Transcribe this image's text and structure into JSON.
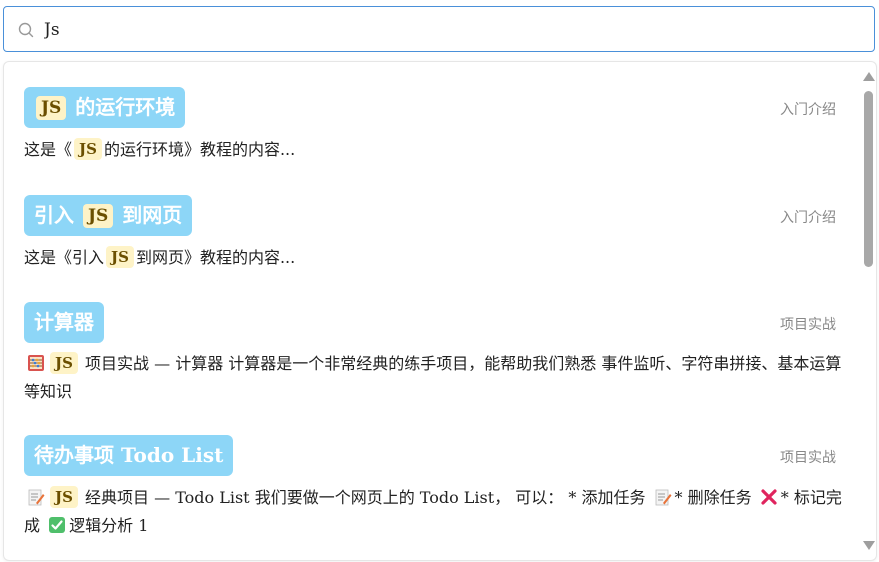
{
  "search": {
    "value": "Js",
    "placeholder": ""
  },
  "results": [
    {
      "title_pre": "",
      "title_hl": "JS",
      "title_post": "的运行环境",
      "category": "入门介绍",
      "desc_pre": "这是《",
      "desc_hl": "JS",
      "desc_post": "的运行环境》教程的内容..."
    },
    {
      "title_pre": "引入",
      "title_hl": "JS",
      "title_post": "到网页",
      "category": "入门介绍",
      "desc_pre": "这是《引入",
      "desc_hl": "JS",
      "desc_post": "到网页》教程的内容..."
    },
    {
      "title": "计算器",
      "category": "项目实战",
      "desc_hl": "JS",
      "desc_post": "项目实战 — 计算器 计算器是一个非常经典的练手项目，能帮助我们熟悉 事件监听、字符串拼接、基本运算 等知识",
      "icons": [
        "abacus-icon"
      ]
    },
    {
      "title": "待办事项 Todo List",
      "category": "项目实战",
      "desc_hl": "JS",
      "desc_part1": "经典项目 — Todo List 我们要做一个网页上的 Todo List， 可以： * 添加任务",
      "desc_part2": "* 删除任务",
      "desc_part3": "* 标记完成",
      "desc_part4": "逻辑分析 1",
      "icons": [
        "memo-icon",
        "memo-icon",
        "cross-mark-icon",
        "check-mark-icon"
      ]
    }
  ],
  "colors": {
    "title_pill_bg": "#8dd6f7",
    "highlight_bg": "#fef3c7",
    "search_border": "#4a90d9"
  }
}
